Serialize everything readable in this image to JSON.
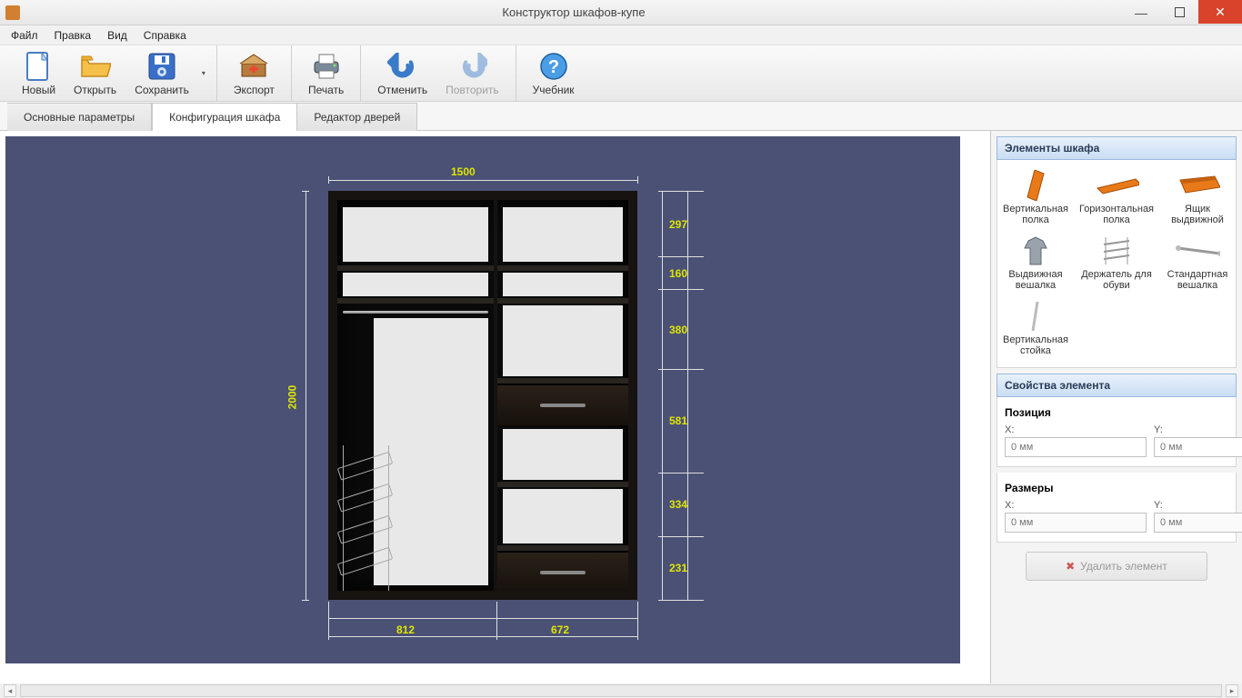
{
  "window": {
    "title": "Конструктор шкафов-купе"
  },
  "menu": {
    "file": "Файл",
    "edit": "Правка",
    "view": "Вид",
    "help": "Справка"
  },
  "toolbar": {
    "new": "Новый",
    "open": "Открыть",
    "save": "Сохранить",
    "export": "Экспорт",
    "print": "Печать",
    "undo": "Отменить",
    "redo": "Повторить",
    "tutorial": "Учебник"
  },
  "tabs": {
    "basic": "Основные параметры",
    "config": "Конфигурация шкафа",
    "doors": "Редактор дверей",
    "active": "config"
  },
  "canvas_dims": {
    "width_total": "1500",
    "height_total": "2000",
    "bottom_left": "812",
    "bottom_right": "672",
    "right": [
      "297",
      "160",
      "380",
      "581",
      "334",
      "231"
    ]
  },
  "panel": {
    "elements_header": "Элементы шкафа",
    "elements": [
      "Вертикальная полка",
      "Горизонтальная полка",
      "Ящик выдвижной",
      "Выдвижная вешалка",
      "Держатель для обуви",
      "Стандартная вешалка",
      "Вертикальная стойка"
    ],
    "props_header": "Свойства элемента",
    "position_label": "Позиция",
    "size_label": "Размеры",
    "x_label": "X:",
    "y_label": "Y:",
    "placeholder_x": "0 мм",
    "placeholder_y": "0 мм",
    "delete_label": "Удалить элемент"
  }
}
